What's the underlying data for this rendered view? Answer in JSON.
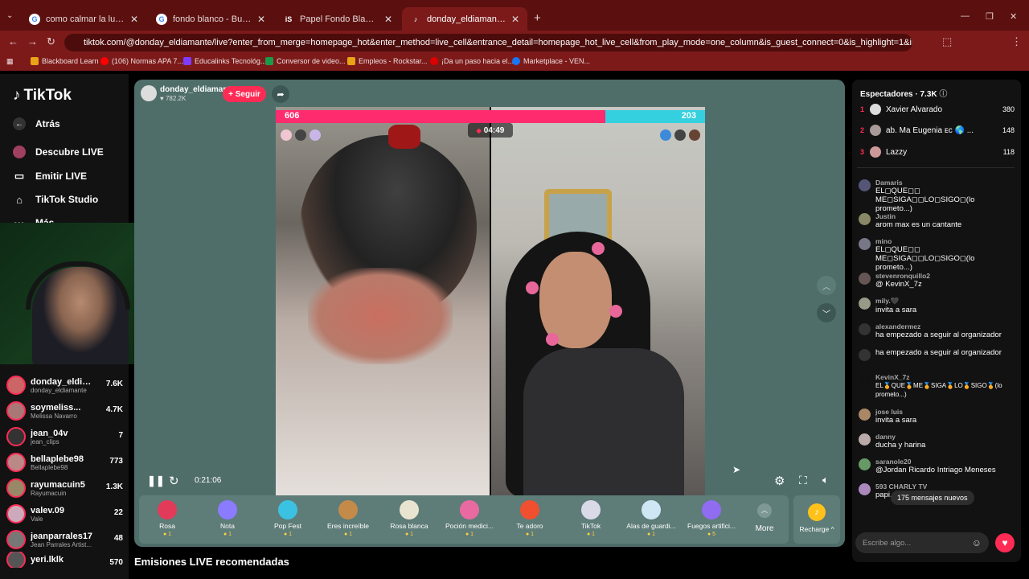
{
  "browser": {
    "tabs": [
      {
        "title": "como calmar la luna de mi pen",
        "icon": "google-icon"
      },
      {
        "title": "fondo blanco - Buscar con Goo",
        "icon": "google-icon"
      },
      {
        "title": "Papel Fondo Blanco - Banco de",
        "icon": "istock-icon"
      },
      {
        "title": "donday_eldiamante (@don",
        "icon": "tiktok-icon"
      }
    ],
    "new_tab": "+",
    "url": "tiktok.com/@donday_eldiamante/live?enter_from_merge=homepage_hot&enter_method=live_cell&entrance_detail=homepage_hot_live_cell&from_play_mode=one_column&is_guest_connect=0&is_highlight=1&is_landscape=0&request_id=2...",
    "bookmarks": [
      "Blackboard Learn",
      "(106) Normas APA 7...",
      "Educalinks Tecnológ...",
      "Conversor de video...",
      "Empleos - Rockstar...",
      "¡Da un paso hacia el...",
      "Marketplace - VEN..."
    ]
  },
  "sidebar": {
    "logo": "TikTok",
    "nav": [
      {
        "label": "Atrás",
        "icon": "back-arrow-icon"
      },
      {
        "label": "Descubre LIVE",
        "icon": "live-icon"
      },
      {
        "label": "Emitir LIVE",
        "icon": "camera-icon"
      },
      {
        "label": "TikTok Studio",
        "icon": "home-icon"
      },
      {
        "label": "Más",
        "icon": "more-icon"
      }
    ],
    "creators": [
      {
        "name": "donday_eldia...",
        "handle": "donday_eldiamante",
        "count": "7.6K"
      },
      {
        "name": "soymeliss...",
        "handle": "Melissa Navarro",
        "count": "4.7K"
      },
      {
        "name": "jean_04v",
        "handle": "jean_clips",
        "count": "7"
      },
      {
        "name": "bellaplebe98",
        "handle": "Bellaplebe98",
        "count": "773"
      },
      {
        "name": "rayumacuin5",
        "handle": "Rayumacuin",
        "count": "1.3K"
      },
      {
        "name": "valev.09",
        "handle": "Vale",
        "count": "22"
      },
      {
        "name": "jeanparrales17",
        "handle": "Jean Parrales Artist...",
        "count": "48"
      },
      {
        "name": "yeri.lklk",
        "handle": "",
        "count": "570"
      }
    ]
  },
  "player": {
    "host_name": "donday_eldiamante",
    "host_likes": "782.2K",
    "follow_label": "+ Seguir",
    "score_left": "606",
    "score_right": "203",
    "battle_timer": "04:49",
    "elapsed": "0:21:06",
    "pause_icon": "pause-icon"
  },
  "gifts": [
    {
      "name": "Rosa",
      "cost": "1",
      "color": "#e23b5a"
    },
    {
      "name": "Nota",
      "cost": "1",
      "color": "#8a7bff"
    },
    {
      "name": "Pop Fest",
      "cost": "1",
      "color": "#3bc2e2"
    },
    {
      "name": "Eres increíble",
      "cost": "1",
      "color": "#c48a4a"
    },
    {
      "name": "Rosa blanca",
      "cost": "1",
      "color": "#e9e4cf"
    },
    {
      "name": "Poción medici...",
      "cost": "1",
      "color": "#e96aa0"
    },
    {
      "name": "Te adoro",
      "cost": "1",
      "color": "#f0502f"
    },
    {
      "name": "TikTok",
      "cost": "1",
      "color": "#d9d9e8"
    },
    {
      "name": "Alas de guardi...",
      "cost": "1",
      "color": "#cfe6f5"
    },
    {
      "name": "Fuegos artifici...",
      "cost": "5",
      "color": "#8f6cf0"
    }
  ],
  "gift_more": "More",
  "recharge": "Recharge ^",
  "recommended": "Emisiones LIVE recomendadas",
  "viewers_panel": {
    "title": "Espectadores · 7.3K",
    "top": [
      {
        "rank": "1",
        "name": "Xavier Alvarado",
        "score": "380"
      },
      {
        "rank": "2",
        "name": "ab. Ma Eugenia ᴇᴄ 🌎 ...",
        "score": "148"
      },
      {
        "rank": "3",
        "name": "Lazzy",
        "score": "118"
      }
    ]
  },
  "chat": [
    {
      "user": "Damaris",
      "text": "EL◻QUE◻◻ ME◻SIGA◻◻LO◻SIGO◻(lo prometo...)"
    },
    {
      "user": "Justin",
      "text": "arom max es un cantante"
    },
    {
      "user": "mino",
      "text": "EL◻QUE◻◻ ME◻SIGA◻◻LO◻SIGO◻(lo prometo...)"
    },
    {
      "user": "stevenronquillo2",
      "text": "@ KevinX_7z"
    },
    {
      "user": "mily.🖤",
      "text": "invita a sara"
    },
    {
      "user": "alexandermez",
      "text": "ha empezado a seguir al organizador"
    },
    {
      "user": "",
      "text": "ha empezado a seguir al organizador"
    },
    {
      "user": "KevinX_7z",
      "text": "EL🏅QUE🏅ME🏅SIGA🏅LO🏅SIGO🏅(lo prometo...)"
    },
    {
      "user": "jose luis",
      "text": "invita a sara"
    },
    {
      "user": "danny",
      "text": "ducha y harina"
    },
    {
      "user": "saranole20",
      "text": "@Jordan Ricardo Intriago Meneses"
    },
    {
      "user": "593 CHARLY TV",
      "text": "papi... acolita dame permiso"
    }
  ],
  "new_messages": "175 mensajes nuevos",
  "chat_placeholder": "Escribe algo..."
}
